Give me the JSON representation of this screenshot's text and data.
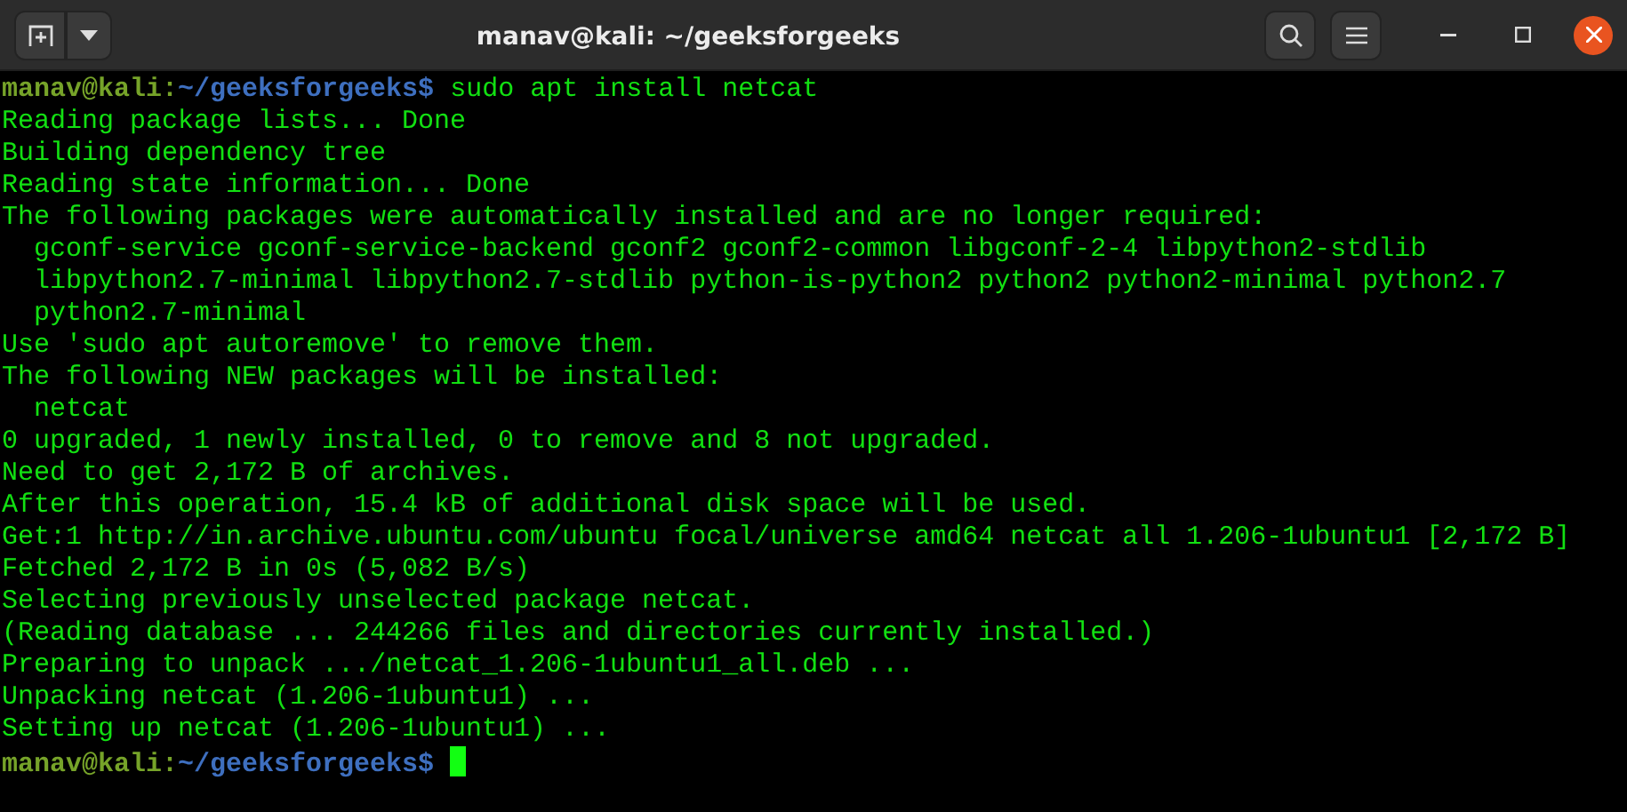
{
  "window": {
    "title": "manav@kali: ~/geeksforgeeks"
  },
  "lines": [
    {
      "kind": "prompt",
      "user_host": "manav@kali:",
      "path": "~/geeksforgeeks",
      "symbol": "$",
      "command": "sudo apt install netcat"
    },
    {
      "kind": "output",
      "text": "Reading package lists... Done"
    },
    {
      "kind": "output",
      "text": "Building dependency tree"
    },
    {
      "kind": "output",
      "text": "Reading state information... Done"
    },
    {
      "kind": "output",
      "text": "The following packages were automatically installed and are no longer required:"
    },
    {
      "kind": "output",
      "text": "  gconf-service gconf-service-backend gconf2 gconf2-common libgconf-2-4 libpython2-stdlib"
    },
    {
      "kind": "output",
      "text": "  libpython2.7-minimal libpython2.7-stdlib python-is-python2 python2 python2-minimal python2.7"
    },
    {
      "kind": "output",
      "text": "  python2.7-minimal"
    },
    {
      "kind": "output",
      "text": "Use 'sudo apt autoremove' to remove them."
    },
    {
      "kind": "output",
      "text": "The following NEW packages will be installed:"
    },
    {
      "kind": "output",
      "text": "  netcat"
    },
    {
      "kind": "output",
      "text": "0 upgraded, 1 newly installed, 0 to remove and 8 not upgraded."
    },
    {
      "kind": "output",
      "text": "Need to get 2,172 B of archives."
    },
    {
      "kind": "output",
      "text": "After this operation, 15.4 kB of additional disk space will be used."
    },
    {
      "kind": "output",
      "text": "Get:1 http://in.archive.ubuntu.com/ubuntu focal/universe amd64 netcat all 1.206-1ubuntu1 [2,172 B]"
    },
    {
      "kind": "output",
      "text": "Fetched 2,172 B in 0s (5,082 B/s)"
    },
    {
      "kind": "output",
      "text": "Selecting previously unselected package netcat."
    },
    {
      "kind": "output",
      "text": "(Reading database ... 244266 files and directories currently installed.)"
    },
    {
      "kind": "output",
      "text": "Preparing to unpack .../netcat_1.206-1ubuntu1_all.deb ..."
    },
    {
      "kind": "output",
      "text": "Unpacking netcat (1.206-1ubuntu1) ..."
    },
    {
      "kind": "output",
      "text": "Setting up netcat (1.206-1ubuntu1) ..."
    },
    {
      "kind": "prompt",
      "user_host": "manav@kali:",
      "path": "~/geeksforgeeks",
      "symbol": "$",
      "cursor": true
    }
  ]
}
